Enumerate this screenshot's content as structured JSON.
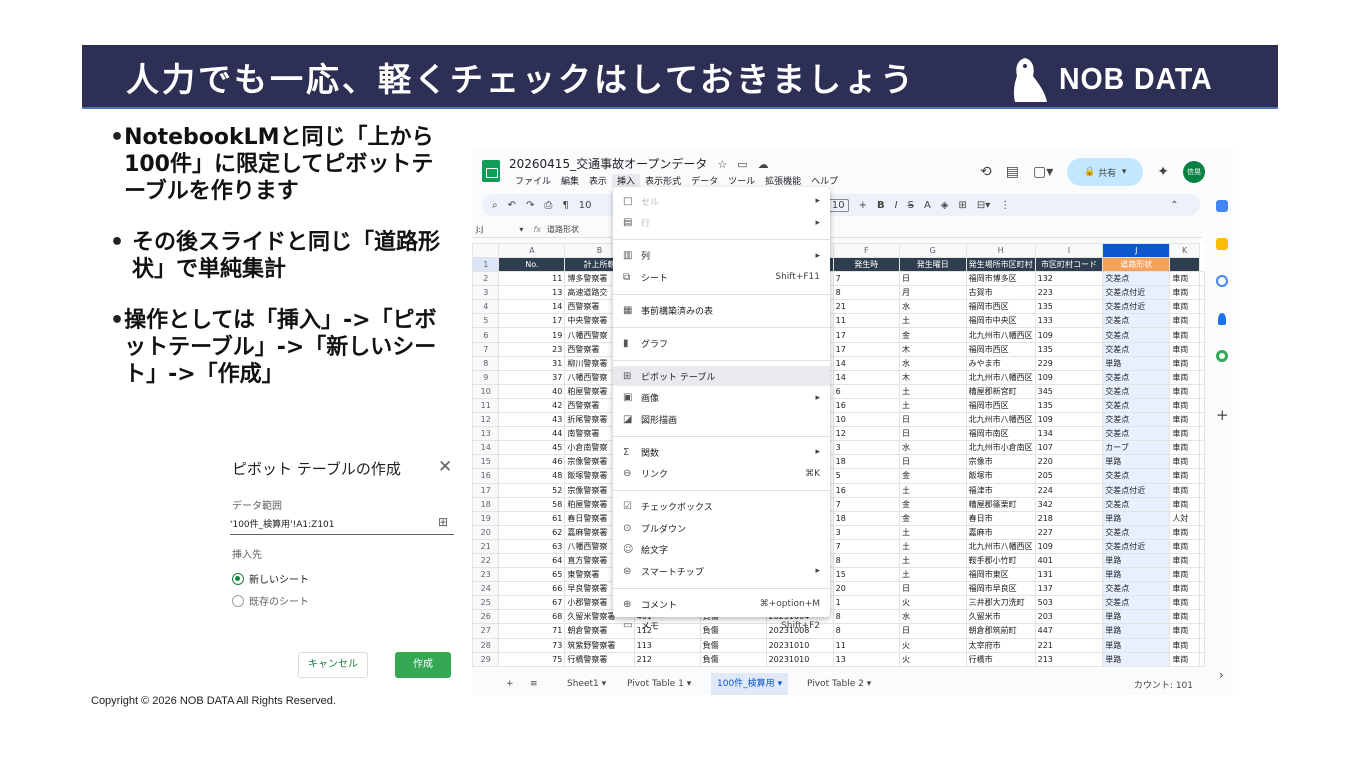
{
  "slide": {
    "title": "人力でも一応、軽くチェックはしておきましょう",
    "logo": "NOB DATA",
    "copyright": "Copyright © 2026 NOB DATA All Rights Reserved."
  },
  "bullets": [
    "NotebookLMと同じ「上から100件」に限定してピボットテーブルを作ります",
    "その後スライドと同じ「道路形状」で単純集計",
    "操作としては「挿入」->「ピボットテーブル」->「新しいシート」->「作成」"
  ],
  "dialog": {
    "title": "ピボット テーブルの作成",
    "close": "✕",
    "range_label": "データ範囲",
    "range_value": "'100件_検算用'!A1:Z101",
    "insert_label": "挿入先",
    "opt_new": "新しいシート",
    "opt_existing": "既存のシート",
    "cancel": "キャンセル",
    "create": "作成"
  },
  "sheet": {
    "title": "20260415_交通事故オープンデータ",
    "menu": [
      "ファイル",
      "編集",
      "表示",
      "挿入",
      "表示形式",
      "データ",
      "ツール",
      "拡張機能",
      "ヘルプ"
    ],
    "share": "共有",
    "avatar": "信晃",
    "cell_ref": "J:J",
    "formula": "道路形状",
    "zoom": "10",
    "font_size": "10",
    "col_letters": [
      "A",
      "B",
      "C",
      "D",
      "E",
      "F",
      "G",
      "H",
      "I",
      "J",
      "K"
    ],
    "headers": [
      "No.",
      "計上所轄",
      "",
      "",
      "",
      "発生時",
      "発生曜日",
      "発生場所市区町村",
      "市区町村コード",
      "道路形状",
      ""
    ],
    "rows": [
      [
        "11",
        "博多警察署",
        "7",
        "日",
        "福岡市博多区",
        "132",
        "交差点",
        "車両"
      ],
      [
        "13",
        "高速道路交",
        "8",
        "月",
        "古賀市",
        "223",
        "交差点付近",
        "車両"
      ],
      [
        "14",
        "西警察署",
        "21",
        "水",
        "福岡市西区",
        "135",
        "交差点付近",
        "車両"
      ],
      [
        "17",
        "中央警察署",
        "11",
        "土",
        "福岡市中央区",
        "133",
        "交差点",
        "車両"
      ],
      [
        "19",
        "八幡西警察",
        "17",
        "金",
        "北九州市八幡西区",
        "109",
        "交差点",
        "車両"
      ],
      [
        "23",
        "西警察署",
        "17",
        "木",
        "福岡市西区",
        "135",
        "交差点",
        "車両"
      ],
      [
        "31",
        "柳川警察署",
        "14",
        "水",
        "みやま市",
        "229",
        "単路",
        "車両"
      ],
      [
        "37",
        "八幡西警察",
        "14",
        "木",
        "北九州市八幡西区",
        "109",
        "交差点",
        "車両"
      ],
      [
        "40",
        "粕屋警察署",
        "6",
        "土",
        "糟屋郡新宮町",
        "345",
        "交差点",
        "車両"
      ],
      [
        "42",
        "西警察署",
        "16",
        "土",
        "福岡市西区",
        "135",
        "交差点",
        "車両"
      ],
      [
        "43",
        "折尾警察署",
        "10",
        "日",
        "北九州市八幡西区",
        "109",
        "交差点",
        "車両"
      ],
      [
        "44",
        "南警察署",
        "12",
        "日",
        "福岡市南区",
        "134",
        "交差点",
        "車両"
      ],
      [
        "45",
        "小倉南警察",
        "3",
        "水",
        "北九州市小倉南区",
        "107",
        "カーブ",
        "車両"
      ],
      [
        "46",
        "宗像警察署",
        "18",
        "日",
        "宗像市",
        "220",
        "単路",
        "車両"
      ],
      [
        "48",
        "飯塚警察署",
        "5",
        "金",
        "飯塚市",
        "205",
        "交差点",
        "車両"
      ],
      [
        "52",
        "宗像警察署",
        "16",
        "土",
        "福津市",
        "224",
        "交差点付近",
        "車両"
      ],
      [
        "58",
        "粕屋警察署",
        "7",
        "金",
        "糟屋郡篠栗町",
        "342",
        "交差点",
        "車両"
      ],
      [
        "61",
        "春日警察署",
        "18",
        "金",
        "春日市",
        "218",
        "単路",
        "人対"
      ],
      [
        "62",
        "嘉麻警察署",
        "3",
        "土",
        "嘉麻市",
        "227",
        "交差点",
        "車両"
      ],
      [
        "63",
        "八幡西警察",
        "7",
        "土",
        "北九州市八幡西区",
        "109",
        "交差点付近",
        "車両"
      ],
      [
        "64",
        "直方警察署",
        "8",
        "土",
        "鞍手郡小竹町",
        "401",
        "単路",
        "車両"
      ],
      [
        "65",
        "東警察署",
        "15",
        "土",
        "福岡市東区",
        "131",
        "単路",
        "車両"
      ],
      [
        "66",
        "早良警察署",
        "20",
        "日",
        "福岡市早良区",
        "137",
        "交差点",
        "車両"
      ],
      [
        "67",
        "小郡警察署",
        "1",
        "火",
        "三井郡大刀洗町",
        "503",
        "交差点",
        "車両"
      ],
      [
        "68",
        "久留米警察署",
        "8",
        "水",
        "久留米市",
        "203",
        "単路",
        "車両"
      ],
      [
        "71",
        "朝倉警察署",
        "8",
        "日",
        "朝倉郡筑前町",
        "447",
        "単路",
        "車両"
      ],
      [
        "73",
        "筑紫野警察署",
        "11",
        "火",
        "太宰府市",
        "221",
        "単路",
        "車両"
      ],
      [
        "75",
        "行橋警察署",
        "13",
        "火",
        "行橋市",
        "213",
        "単路",
        "車両"
      ]
    ],
    "extra_rows": {
      "26": [
        "401",
        "負傷",
        "20231004"
      ],
      "27": [
        "112",
        "負傷",
        "20231008"
      ],
      "28": [
        "113",
        "負傷",
        "20231010"
      ],
      "29": [
        "212",
        "負傷",
        "20231010"
      ]
    },
    "insert_menu": [
      {
        "icon": "□",
        "label": "セル",
        "sc": "▸",
        "dis": true
      },
      {
        "icon": "▤",
        "label": "行",
        "sc": "▸",
        "dis": true
      },
      {
        "icon": "▥",
        "label": "列",
        "sc": "▸"
      },
      {
        "icon": "⧉",
        "label": "シート",
        "sc": "Shift+F11"
      },
      {
        "icon": "▦",
        "label": "事前構築済みの表",
        "sc": ""
      },
      {
        "icon": "▮",
        "label": "グラフ",
        "sc": ""
      },
      {
        "icon": "⊞",
        "label": "ピボット テーブル",
        "sc": "",
        "hov": true
      },
      {
        "icon": "▣",
        "label": "画像",
        "sc": "▸"
      },
      {
        "icon": "◪",
        "label": "図形描画",
        "sc": ""
      },
      {
        "icon": "Σ",
        "label": "関数",
        "sc": "▸"
      },
      {
        "icon": "⊖",
        "label": "リンク",
        "sc": "⌘K"
      },
      {
        "icon": "☑",
        "label": "チェックボックス",
        "sc": ""
      },
      {
        "icon": "⊙",
        "label": "プルダウン",
        "sc": ""
      },
      {
        "icon": "☺",
        "label": "絵文字",
        "sc": ""
      },
      {
        "icon": "⊜",
        "label": "スマートチップ",
        "sc": "▸"
      },
      {
        "icon": "⊕",
        "label": "コメント",
        "sc": "⌘+option+M"
      },
      {
        "icon": "▭",
        "label": "メモ",
        "sc": "Shift+F2"
      }
    ],
    "tabs": [
      "Sheet1",
      "Pivot Table 1",
      "100件_検算用",
      "Pivot Table 2"
    ],
    "count": "カウント: 101"
  },
  "colors": {
    "banner": "#2d2f54",
    "header_row": "#2f3e4e",
    "accent_green": "#34a853"
  }
}
